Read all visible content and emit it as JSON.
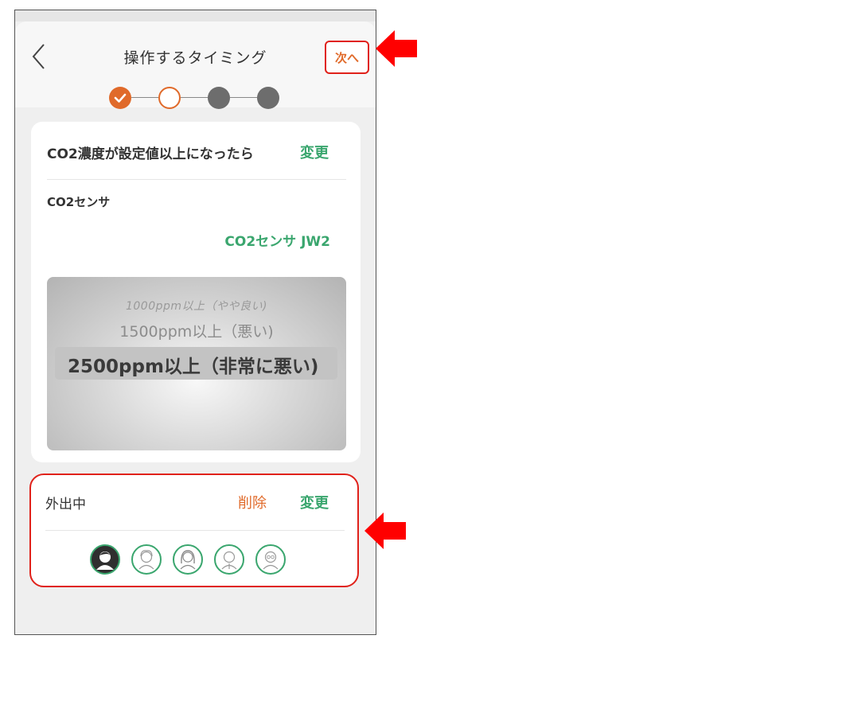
{
  "header": {
    "title": "操作するタイミング",
    "next_label": "次へ"
  },
  "stepper": {
    "steps": [
      "done",
      "current",
      "todo",
      "todo"
    ]
  },
  "trigger_card": {
    "condition_label": "CO2濃度が設定値以上になったら",
    "change_label": "変更",
    "sensor_label": "CO2センサ",
    "sensor_value": "CO2センサ JW2",
    "picker_options": [
      "1000ppm以上（やや良い)",
      "1500ppm以上（悪い)",
      "2500ppm以上（非常に悪い)"
    ],
    "picker_selected": "2500ppm以上（非常に悪い)"
  },
  "condition_card": {
    "label": "外出中",
    "delete_label": "削除",
    "change_label": "変更",
    "avatars": [
      "user-1",
      "user-2",
      "user-3",
      "user-4",
      "user-5"
    ]
  },
  "colors": {
    "accent_orange": "#e06a2a",
    "accent_green": "#3aa66e",
    "highlight_red": "#e0211a"
  }
}
